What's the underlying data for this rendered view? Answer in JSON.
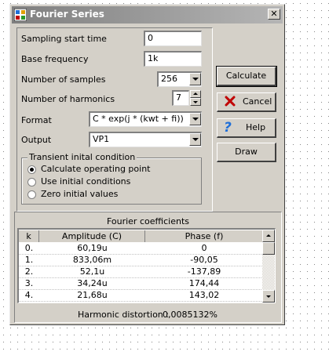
{
  "window": {
    "title": "Fourier Series",
    "close_label": "✕"
  },
  "fields": {
    "sampling_start_time": {
      "label": "Sampling start time",
      "value": "0"
    },
    "base_frequency": {
      "label": "Base frequency",
      "value": "1k"
    },
    "number_of_samples": {
      "label": "Number of samples",
      "value": "256"
    },
    "number_of_harmonics": {
      "label": "Number of harmonics",
      "value": "7"
    },
    "format": {
      "label": "Format",
      "value": "C * exp(j * (kwt + fi))"
    },
    "output": {
      "label": "Output",
      "value": "VP1"
    }
  },
  "transient": {
    "title": "Transient inital condition",
    "options": [
      {
        "label": "Calculate operating point",
        "selected": true
      },
      {
        "label": "Use initial conditions",
        "selected": false
      },
      {
        "label": "Zero initial values",
        "selected": false
      }
    ]
  },
  "buttons": {
    "calculate": "Calculate",
    "cancel": "Cancel",
    "help": "Help",
    "draw": "Draw"
  },
  "coefficients": {
    "title": "Fourier coefficients",
    "columns": [
      "k",
      "Amplitude (C)",
      "Phase (f)"
    ],
    "rows": [
      [
        "0.",
        "60,19u",
        "0"
      ],
      [
        "1.",
        "833,06m",
        "-90,05"
      ],
      [
        "2.",
        "52,1u",
        "-137,89"
      ],
      [
        "3.",
        "34,24u",
        "174,44"
      ],
      [
        "4.",
        "21,68u",
        "143,02"
      ]
    ],
    "distortion_label": "Harmonic distortion :",
    "distortion_value": "0,0085132%"
  },
  "colors": {
    "cancel_icon": "#c00000",
    "help_icon": "#1f6fd8",
    "title_gradient_start": "#7f7f7f"
  }
}
